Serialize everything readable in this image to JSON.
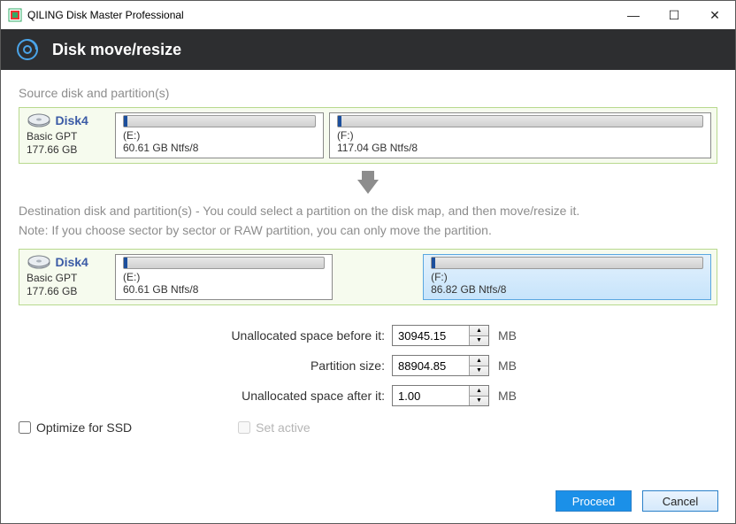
{
  "window": {
    "title": "QILING Disk Master Professional"
  },
  "ribbon": {
    "heading": "Disk move/resize"
  },
  "section": {
    "source_label": "Source disk and partition(s)",
    "dest_line1": "Destination disk and partition(s) - You could select a partition on the disk map, and then move/resize it.",
    "dest_line2": "Note: If you choose sector by sector or RAW partition, you can only move the partition."
  },
  "source_disk": {
    "name": "Disk4",
    "type": "Basic GPT",
    "size": "177.66 GB",
    "partitions": [
      {
        "letter": "(E:)",
        "desc": "60.61 GB Ntfs/8"
      },
      {
        "letter": "(F:)",
        "desc": "117.04 GB Ntfs/8"
      }
    ]
  },
  "dest_disk": {
    "name": "Disk4",
    "type": "Basic GPT",
    "size": "177.66 GB",
    "partitions": [
      {
        "letter": "(E:)",
        "desc": "60.61 GB Ntfs/8",
        "selected": false,
        "gap_after": true
      },
      {
        "letter": "(F:)",
        "desc": "86.82 GB Ntfs/8",
        "selected": true
      }
    ]
  },
  "form": {
    "before_label": "Unallocated space before it:",
    "before_value": "30945.15",
    "size_label": "Partition size:",
    "size_value": "88904.85",
    "after_label": "Unallocated space after it:",
    "after_value": "1.00",
    "unit": "MB"
  },
  "checks": {
    "ssd": "Optimize for SSD",
    "active": "Set active"
  },
  "buttons": {
    "proceed": "Proceed",
    "cancel": "Cancel"
  }
}
